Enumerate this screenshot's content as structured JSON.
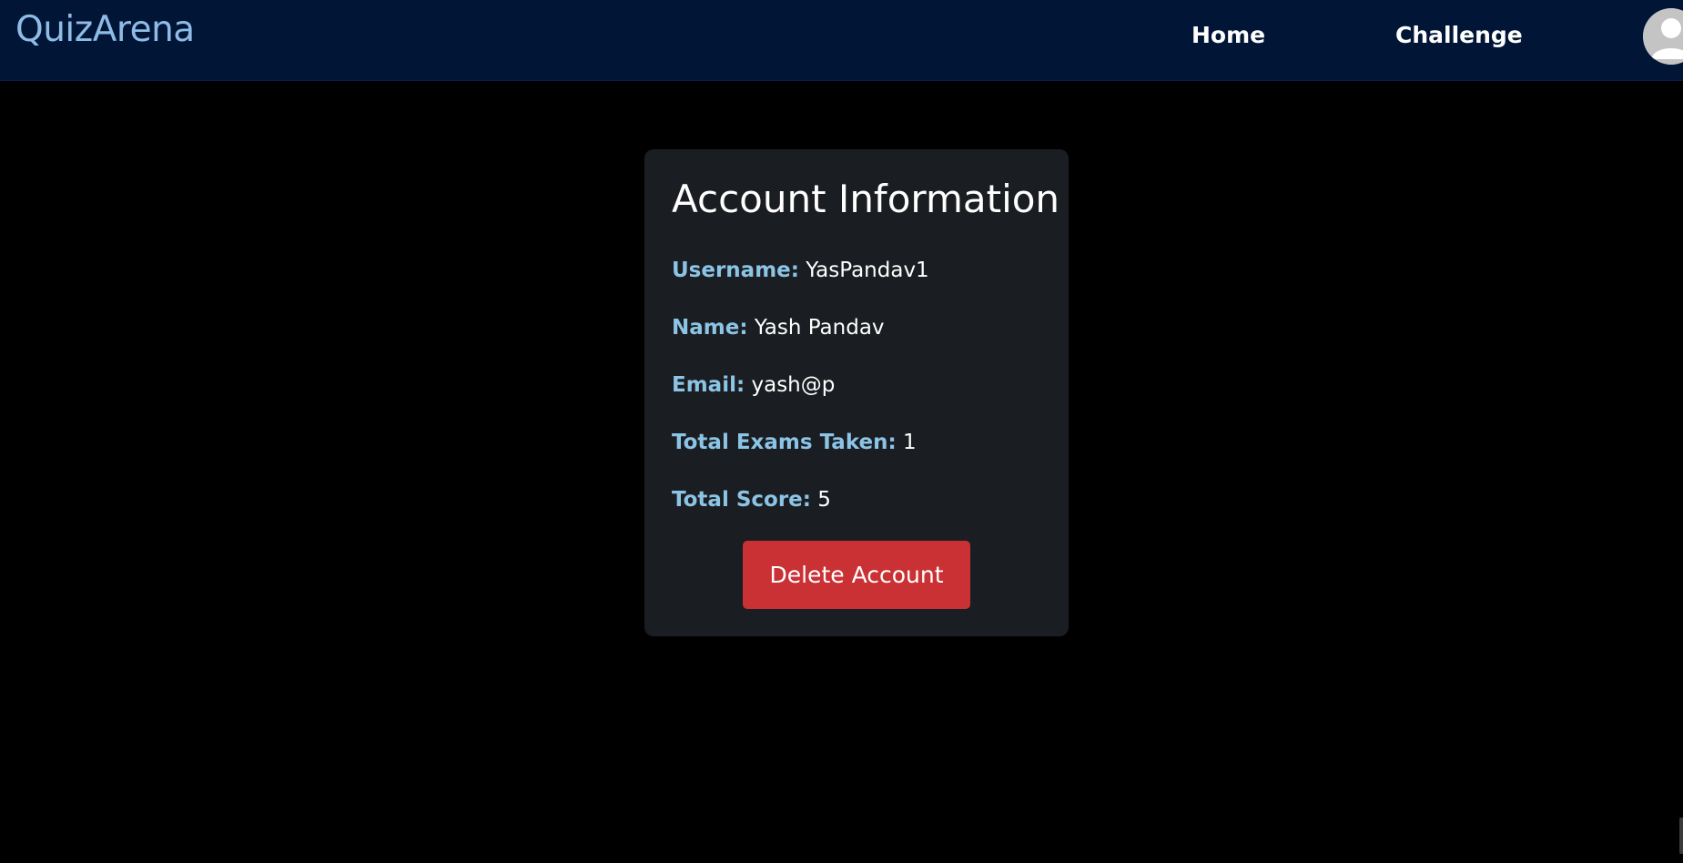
{
  "nav": {
    "brand": "QuizArena",
    "links": [
      {
        "label": "Home"
      },
      {
        "label": "Challenge"
      }
    ],
    "avatar_icon": "user-avatar-icon"
  },
  "account": {
    "title": "Account Information",
    "username_label": "Username:",
    "username_value": "YasPandav1",
    "name_label": "Name:",
    "name_value": "Yash Pandav",
    "email_label": "Email:",
    "email_value": "yash@p",
    "exams_label": "Total Exams Taken:",
    "exams_value": "1",
    "score_label": "Total Score:",
    "score_value": "5",
    "delete_label": "Delete Account"
  },
  "colors": {
    "navbar_bg": "#011537",
    "brand": "#8fbce6",
    "page_bg": "#000000",
    "card_bg": "#1a1d21",
    "label": "#8cc4e6",
    "danger": "#c93134"
  }
}
